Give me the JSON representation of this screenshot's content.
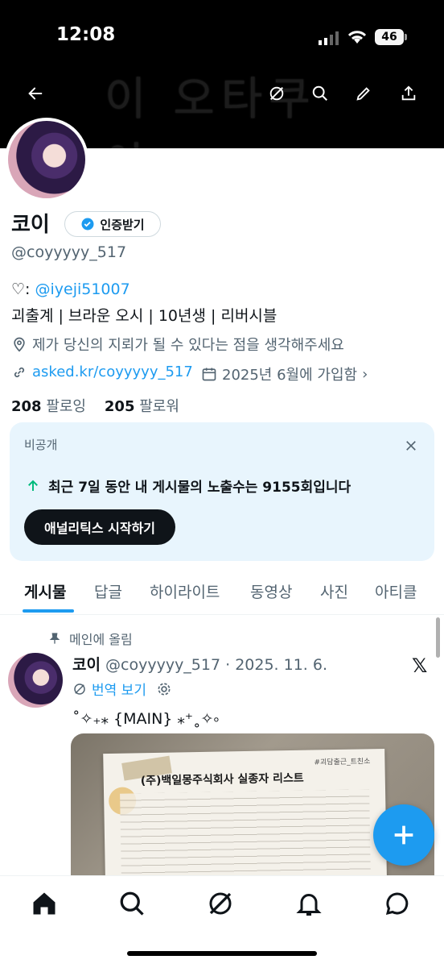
{
  "status_bar": {
    "time": "12:08",
    "battery": "46"
  },
  "banner": {
    "text": "이 오타쿠야"
  },
  "profile": {
    "name": "코이",
    "verify_label": "인증받기",
    "handle": "@coyyyyy_517",
    "bio_prefix": "♡: ",
    "bio_link": "@iyeji51007",
    "bio_line2": "괴출계 | 브라운 오시 | 10년생 | 리버시블",
    "location": "제가 당신의 지뢰가 될 수 있다는 점을 생각해주세요",
    "website": "asked.kr/coyyyyy_517",
    "joined": "2025년 6월에 가입함",
    "following_count": "208",
    "following_label": "팔로잉",
    "followers_count": "205",
    "followers_label": "팔로워"
  },
  "analytics_card": {
    "label": "비공개",
    "message": "최근 7일 동안 내 게시물의 노출수는 9155회입니다",
    "button": "애널리틱스 시작하기"
  },
  "tabs": [
    {
      "label": "게시물",
      "active": true
    },
    {
      "label": "답글"
    },
    {
      "label": "하이라이트"
    },
    {
      "label": "동영상"
    },
    {
      "label": "사진"
    },
    {
      "label": "아티클"
    }
  ],
  "post": {
    "pinned_label": "메인에 올림",
    "author": "코이",
    "handle_date": "@coyyyyy_517 · 2025. 11. 6.",
    "translate": "번역 보기",
    "text": "˚✧₊⁎ {MAIN} ⁎⁺˳✧༚",
    "media": {
      "doc_title": "(주)백일몽주식회사 실종자 리스트",
      "doc_tag": "#괴담출근_트친소"
    }
  },
  "colors": {
    "accent": "#1d9bf0",
    "card_bg": "#e8f5fd",
    "text": "#0f1419",
    "muted": "#536471"
  },
  "icons": [
    "back-arrow-icon",
    "grok-icon",
    "search-icon",
    "edit-icon",
    "share-icon",
    "verified-icon",
    "heart-icon",
    "location-icon",
    "link-icon",
    "calendar-icon",
    "close-icon",
    "arrow-up-icon",
    "pin-icon",
    "translate-icon",
    "gear-icon",
    "x-logo-icon",
    "plus-icon",
    "home-icon",
    "notifications-icon",
    "messages-icon"
  ]
}
